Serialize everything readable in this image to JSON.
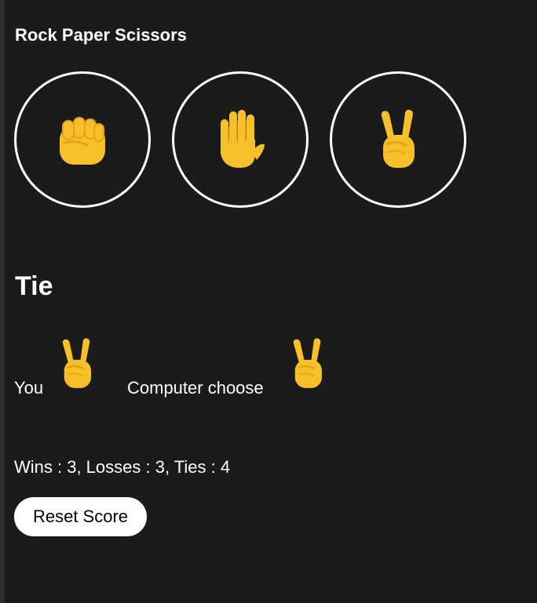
{
  "app": {
    "title": "Rock Paper Scissors"
  },
  "choices": [
    {
      "name": "rock",
      "icon": "raised-fist-icon"
    },
    {
      "name": "paper",
      "icon": "raised-hand-icon"
    },
    {
      "name": "scissors",
      "icon": "victory-hand-icon"
    }
  ],
  "result": {
    "text": "Tie"
  },
  "moves": {
    "you_label": "You",
    "you_choice_icon": "victory-hand-icon",
    "computer_label": "Computer choose",
    "computer_choice_icon": "victory-hand-icon"
  },
  "score": {
    "text": "Wins : 3, Losses : 3, Ties : 4"
  },
  "reset": {
    "label": "Reset Score"
  },
  "colors": {
    "background": "#1b1b1b",
    "emoji_yellow": "#f7c02b",
    "emoji_shade": "#e5a21a"
  }
}
